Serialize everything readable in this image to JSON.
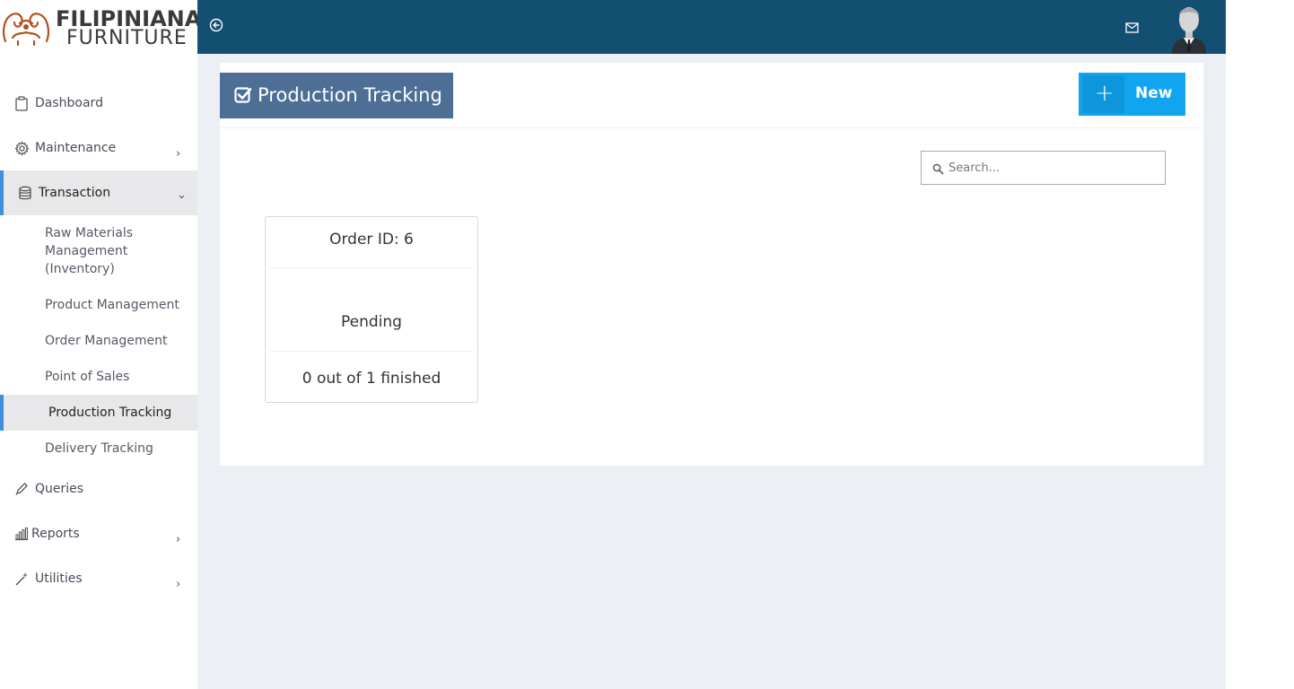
{
  "brand": {
    "line1": "FILIPINIANA",
    "line2": "FURNITURE"
  },
  "sidebar": {
    "items": [
      {
        "label": "Dashboard",
        "icon": "clipboard-icon"
      },
      {
        "label": "Maintenance",
        "icon": "gear-icon",
        "expandable": true
      },
      {
        "label": "Transaction",
        "icon": "database-icon",
        "expanded": true,
        "active": true
      },
      {
        "label": "Queries",
        "icon": "pencil-icon"
      },
      {
        "label": "Reports",
        "icon": "bar-chart-icon",
        "expandable": true
      },
      {
        "label": "Utilities",
        "icon": "wand-icon",
        "expandable": true
      }
    ],
    "transaction_sub": [
      {
        "label": "Raw Materials Management (Inventory)"
      },
      {
        "label": "Product Management"
      },
      {
        "label": "Order Management"
      },
      {
        "label": "Point of Sales"
      },
      {
        "label": "Production Tracking",
        "active": true
      },
      {
        "label": "Delivery Tracking"
      }
    ]
  },
  "topbar": {
    "back_icon": "circle-arrow-left-icon",
    "mail_icon": "envelope-icon",
    "avatar_icon": "user-avatar-icon"
  },
  "page": {
    "title": "Production Tracking",
    "title_icon": "check-square-icon",
    "new_button": "New",
    "search_placeholder": "Search..."
  },
  "orders": [
    {
      "order_label": "Order ID: 6",
      "status": "Pending",
      "progress": "0 out of 1 finished"
    }
  ],
  "colors": {
    "topbar": "#134f70",
    "title_bg": "#4d6f96",
    "new_button": "#12a5ef",
    "active_accent": "#3d8fe0",
    "content_bg": "#eceff4"
  }
}
